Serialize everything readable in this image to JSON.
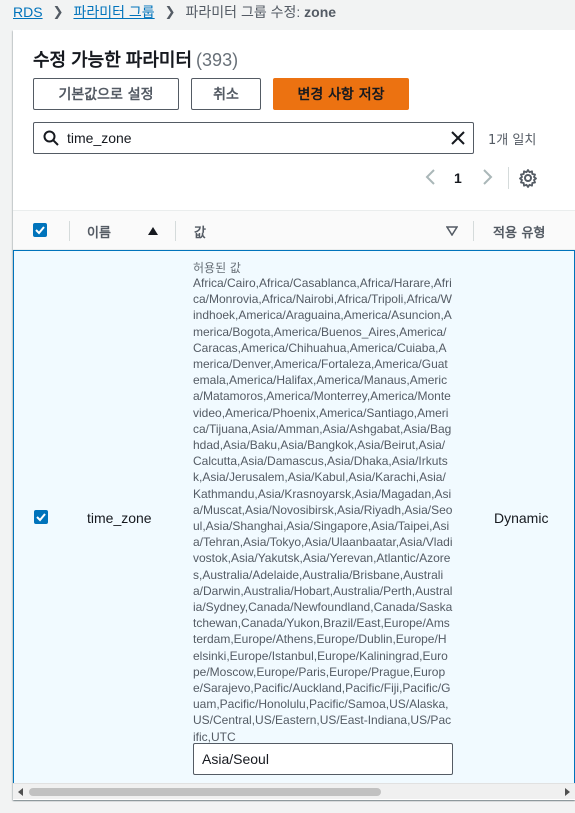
{
  "breadcrumb": {
    "root": "RDS",
    "groups": "파라미터 그룹",
    "current_prefix": "파라미터 그룹 수정: ",
    "current_name": "zone"
  },
  "header": {
    "title": "수정 가능한 파라미터",
    "count": "(393)"
  },
  "actions": {
    "reset_label": "기본값으로 설정",
    "cancel_label": "취소",
    "save_label": "변경 사항 저장"
  },
  "search": {
    "value": "time_zone",
    "match_count": "1개 일치"
  },
  "pagination": {
    "page": "1"
  },
  "table": {
    "columns": {
      "name": "이름",
      "value": "값",
      "apply_type": "적용 유형"
    },
    "rows": [
      {
        "name": "time_zone",
        "allowed_label": "허용된 값",
        "allowed_values": "Africa/Cairo,Africa/Casablanca,Africa/Harare,Africa/Monrovia,Africa/Nairobi,Africa/Tripoli,Africa/Windhoek,America/Araguaina,America/Asuncion,America/Bogota,America/Buenos_Aires,America/Caracas,America/Chihuahua,America/Cuiaba,America/Denver,America/Fortaleza,America/Guatemala,America/Halifax,America/Manaus,America/Matamoros,America/Monterrey,America/Montevideo,America/Phoenix,America/Santiago,America/Tijuana,Asia/Amman,Asia/Ashgabat,Asia/Baghdad,Asia/Baku,Asia/Bangkok,Asia/Beirut,Asia/Calcutta,Asia/Damascus,Asia/Dhaka,Asia/Irkutsk,Asia/Jerusalem,Asia/Kabul,Asia/Karachi,Asia/Kathmandu,Asia/Krasnoyarsk,Asia/Magadan,Asia/Muscat,Asia/Novosibirsk,Asia/Riyadh,Asia/Seoul,Asia/Shanghai,Asia/Singapore,Asia/Taipei,Asia/Tehran,Asia/Tokyo,Asia/Ulaanbaatar,Asia/Vladivostok,Asia/Yakutsk,Asia/Yerevan,Atlantic/Azores,Australia/Adelaide,Australia/Brisbane,Australia/Darwin,Australia/Hobart,Australia/Perth,Australia/Sydney,Canada/Newfoundland,Canada/Saskatchewan,Canada/Yukon,Brazil/East,Europe/Amsterdam,Europe/Athens,Europe/Dublin,Europe/Helsinki,Europe/Istanbul,Europe/Kaliningrad,Europe/Moscow,Europe/Paris,Europe/Prague,Europe/Sarajevo,Pacific/Auckland,Pacific/Fiji,Pacific/Guam,Pacific/Honolulu,Pacific/Samoa,US/Alaska,US/Central,US/Eastern,US/East-Indiana,US/Pacific,UTC",
        "value": "Asia/Seoul",
        "apply_type": "Dynamic"
      }
    ]
  },
  "icons": {
    "search": "search-icon",
    "clear": "close-icon",
    "prev": "chevron-left-icon",
    "next": "chevron-right-icon",
    "settings": "gear-icon"
  },
  "colors": {
    "link": "#0073bb",
    "primary": "#ec7211",
    "selected_row_bg": "#f1faff",
    "checkbox": "#0073bb"
  }
}
